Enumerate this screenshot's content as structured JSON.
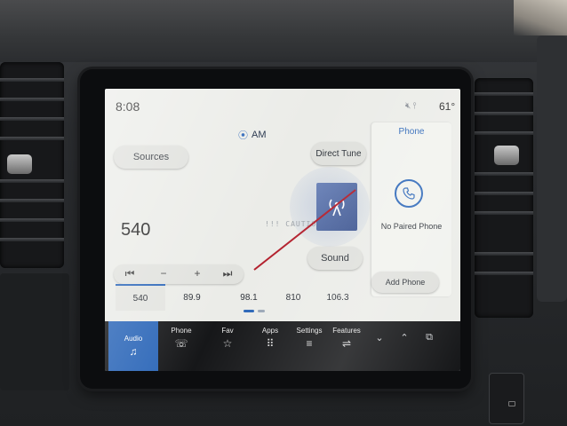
{
  "status": {
    "time": "8:08",
    "temperature": "61°"
  },
  "header": {
    "band": "AM",
    "band_icon": "radio-signal-icon"
  },
  "buttons": {
    "sources": "Sources",
    "direct_tune": "Direct Tune",
    "sound": "Sound"
  },
  "station": {
    "frequency": "540",
    "artwork_icon": "radio-tower-icon",
    "faint_text": "!!! CAUTIO"
  },
  "transport": {
    "prev": "⏮",
    "minus": "−",
    "plus": "+",
    "next": "⏭"
  },
  "presets": [
    "540",
    "89.9",
    "98.1",
    "810",
    "106.3"
  ],
  "phone": {
    "title": "Phone",
    "status": "No Paired Phone",
    "add_button": "Add Phone"
  },
  "dock": {
    "items": [
      {
        "label": "Audio",
        "icon": "♫"
      },
      {
        "label": "Phone",
        "icon": "☏"
      },
      {
        "label": "Fav",
        "icon": "☆"
      },
      {
        "label": "Apps",
        "icon": "⠿"
      },
      {
        "label": "Settings",
        "icon": "≡"
      },
      {
        "label": "Features",
        "icon": "⇌"
      }
    ],
    "controls": [
      "⌄",
      "⌃",
      "⧉"
    ]
  },
  "colors": {
    "accent": "#2b66b8",
    "screen_bg": "#ebece8",
    "dock_bg": "#161719"
  }
}
